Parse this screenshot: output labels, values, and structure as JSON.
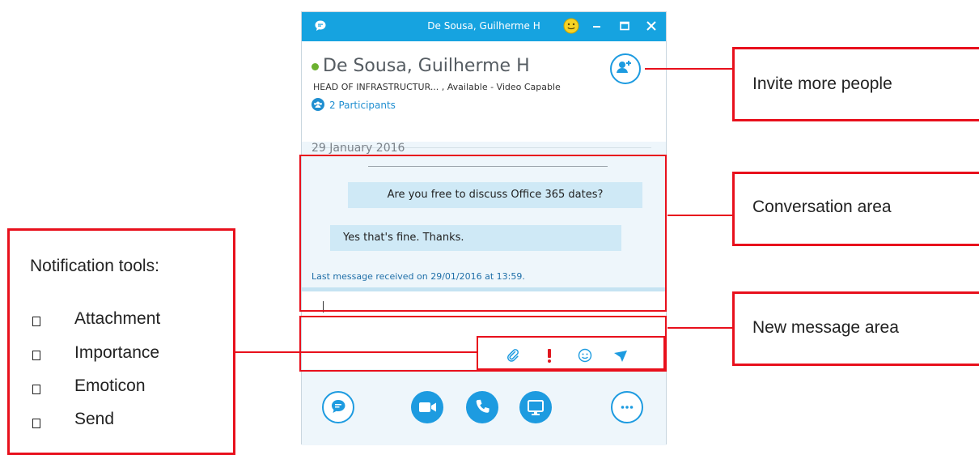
{
  "window": {
    "title": "De Sousa, Guilherme H",
    "accent_color": "#16a3e0",
    "header": {
      "contact_name": "De Sousa, Guilherme H",
      "presence": "Available",
      "subtitle": "HEAD OF INFRASTRUCTUR... , Available - Video Capable",
      "participants": "2 Participants"
    },
    "conversation": {
      "date": "29 January 2016",
      "messages": [
        {
          "text": "Are you free to discuss Office 365 dates?"
        },
        {
          "text": "Yes that's fine. Thanks."
        }
      ],
      "last_message": "Last message received on 29/01/2016 at 13:59."
    },
    "compose_tools": [
      "paperclip-icon",
      "exclamation-icon",
      "smiley-icon",
      "send-arrow-icon"
    ],
    "bottom_actions": [
      "chat-icon",
      "video-icon",
      "phone-icon",
      "screen-share-icon",
      "more-icon"
    ]
  },
  "callouts": {
    "invite": "Invite more people",
    "conversation": "Conversation area",
    "new_message": "New message area",
    "notification_title": "Notification tools:",
    "notification_items": [
      "Attachment",
      "Importance",
      "Emoticon",
      "Send"
    ],
    "line_color": "#e8101c"
  }
}
